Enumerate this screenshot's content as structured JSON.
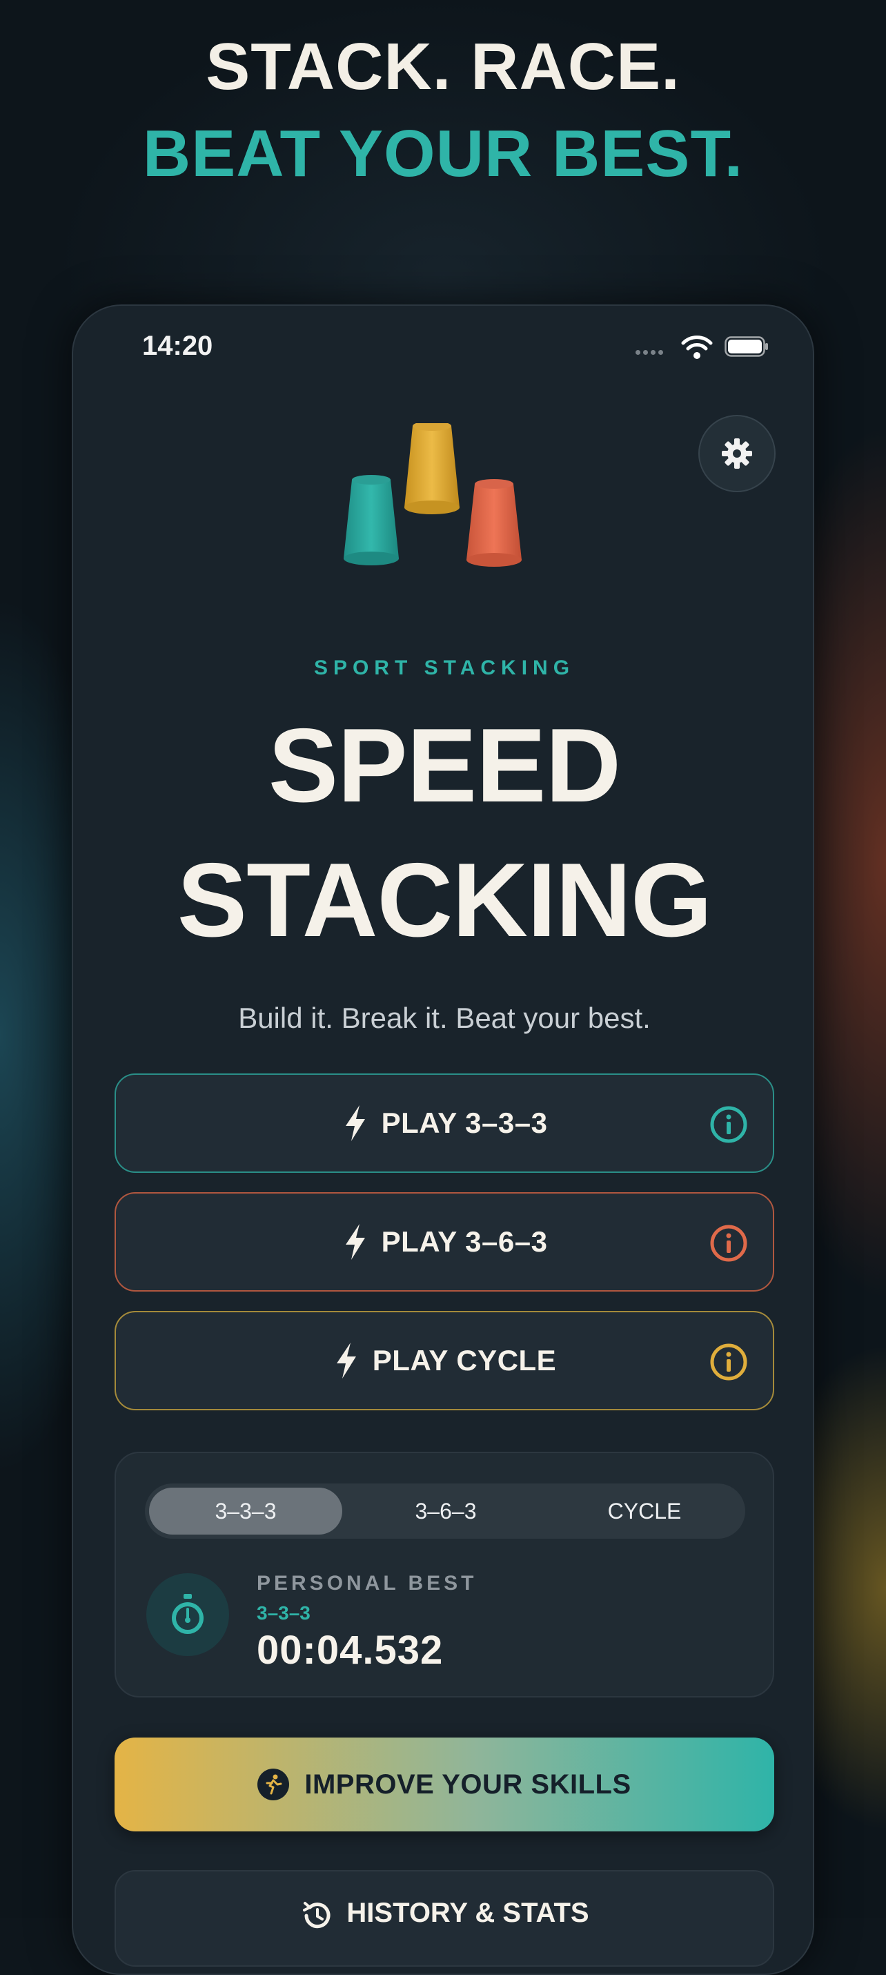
{
  "promo": {
    "line1": "STACK. RACE.",
    "line2": "BEAT YOUR BEST."
  },
  "status_bar": {
    "time": "14:20"
  },
  "hero": {
    "kicker": "SPORT STACKING",
    "title_line1": "SPEED",
    "title_line2": "STACKING",
    "tagline": "Build it. Break it. Beat your best."
  },
  "play_buttons": [
    {
      "label": "PLAY 3–3–3",
      "accent": "#2fb4a8"
    },
    {
      "label": "PLAY 3–6–3",
      "accent": "#e06a4a"
    },
    {
      "label": "PLAY CYCLE",
      "accent": "#e0ae3c"
    }
  ],
  "stats": {
    "tabs": [
      "3–3–3",
      "3–6–3",
      "CYCLE"
    ],
    "selected_tab": "3–3–3",
    "personal_best_label": "PERSONAL BEST",
    "mode": "3–3–3",
    "time": "00:04.532"
  },
  "improve_button": {
    "label": "IMPROVE YOUR SKILLS"
  },
  "history_button": {
    "label": "HISTORY & STATS"
  },
  "colors": {
    "teal": "#2fb4a8",
    "coral": "#e06a4a",
    "gold": "#e0ae3c",
    "background": "#0d151b"
  },
  "icons": [
    "settings-gear-icon",
    "bolt-icon",
    "info-icon",
    "stopwatch-icon",
    "running-icon",
    "history-icon",
    "wifi-icon",
    "battery-icon"
  ]
}
